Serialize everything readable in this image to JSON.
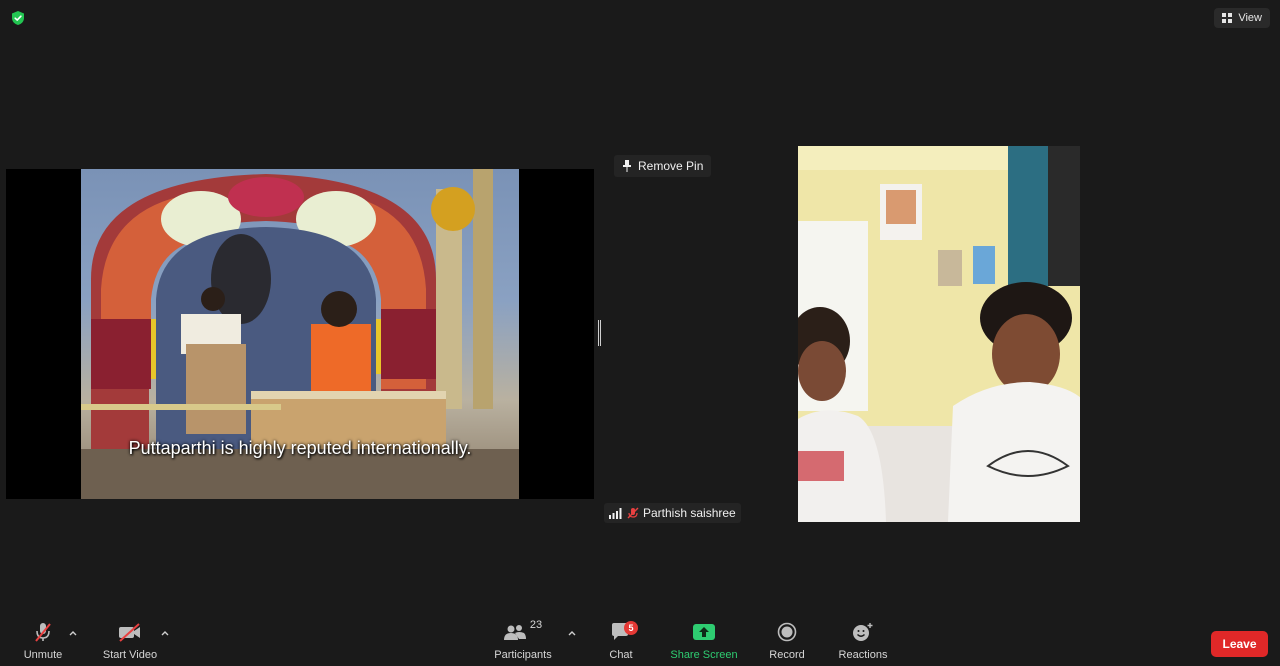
{
  "top": {
    "view_label": "View"
  },
  "shared_screen": {
    "caption": "Puttaparthi is highly reputed internationally."
  },
  "pin": {
    "remove_pin_label": "Remove Pin"
  },
  "participant": {
    "name": "Parthish saishree"
  },
  "toolbar": {
    "unmute_label": "Unmute",
    "start_video_label": "Start Video",
    "participants_label": "Participants",
    "participants_count": "23",
    "chat_label": "Chat",
    "chat_badge": "5",
    "share_screen_label": "Share Screen",
    "record_label": "Record",
    "reactions_label": "Reactions",
    "leave_label": "Leave"
  },
  "colors": {
    "leave": "#e02828",
    "share_green": "#2ecc71",
    "secure_green": "#23c552",
    "badge_red": "#e53935"
  }
}
